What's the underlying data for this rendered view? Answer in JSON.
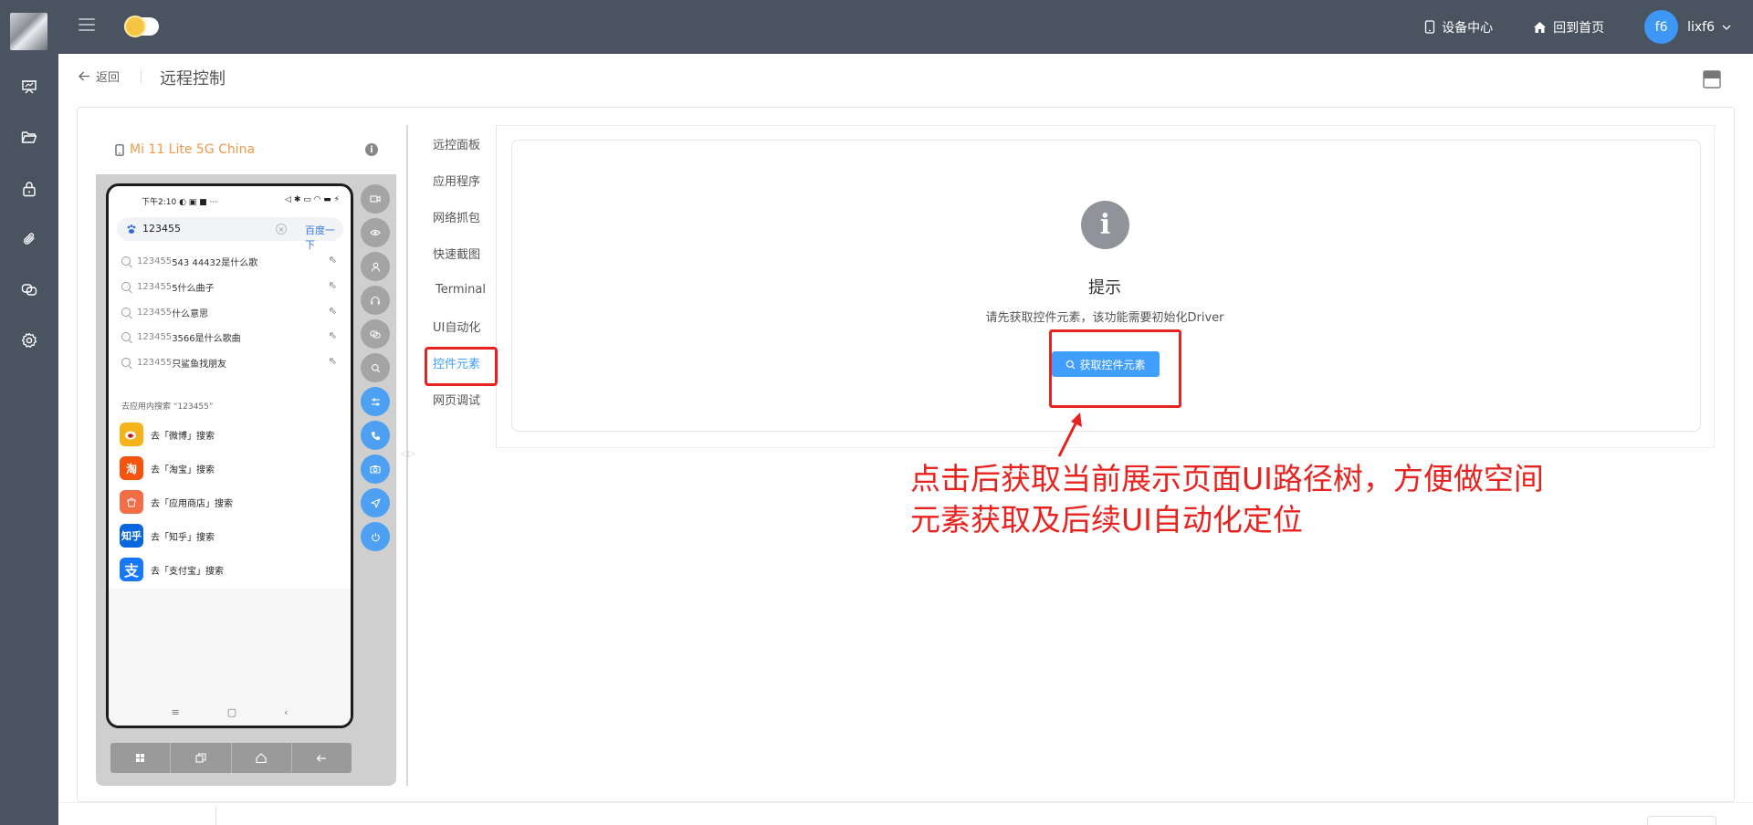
{
  "topbar": {
    "device_center": "设备中心",
    "back_home": "回到首页",
    "avatar_initials": "f6",
    "username": "lixf6"
  },
  "header": {
    "back_label": "返回",
    "title": "远程控制"
  },
  "device": {
    "name": "Mi 11 Lite 5G China",
    "status_time": "下午2:10",
    "search_value": "123455",
    "search_go": "百度一下",
    "suggestions": [
      {
        "prefix": "123455",
        "rest": "543 44432是什么歌"
      },
      {
        "prefix": "123455",
        "rest": "5什么曲子"
      },
      {
        "prefix": "123455",
        "rest": "什么意思"
      },
      {
        "prefix": "123455",
        "rest": "3566是什么歌曲"
      },
      {
        "prefix": "123455",
        "rest": "只鲨鱼找朋友"
      }
    ],
    "app_search_hint": "去应用内搜索 “123455”",
    "apps": [
      {
        "label": "去「微博」搜索",
        "icon": "weibo-icon",
        "color": "#f5b31b"
      },
      {
        "label": "去「淘宝」搜索",
        "icon": "taobao-icon",
        "color": "#f5530e",
        "glyph": "淘"
      },
      {
        "label": "去「应用商店」搜索",
        "icon": "app-store-icon",
        "color": "#f26e47"
      },
      {
        "label": "去「知乎」搜索",
        "icon": "zhihu-icon",
        "color": "#0a66db",
        "glyph": "知乎"
      },
      {
        "label": "去「支付宝」搜索",
        "icon": "alipay-icon",
        "color": "#1677ff",
        "glyph": "支"
      }
    ]
  },
  "tabs": [
    {
      "label": "远控面板",
      "active": false
    },
    {
      "label": "应用程序",
      "active": false
    },
    {
      "label": "网络抓包",
      "active": false
    },
    {
      "label": "快速截图",
      "active": false
    },
    {
      "label": "Terminal",
      "active": false
    },
    {
      "label": "UI自动化",
      "active": false
    },
    {
      "label": "控件元素",
      "active": true
    },
    {
      "label": "网页调试",
      "active": false
    }
  ],
  "tip": {
    "icon": "i",
    "title": "提示",
    "description": "请先获取控件元素，该功能需要初始化Driver",
    "button": "获取控件元素"
  },
  "annotation": {
    "line1": "点击后获取当前展示页面UI路径树，方便做空间",
    "line2": "元素获取及后续UI自动化定位"
  },
  "colors": {
    "topbar": "#4a5460",
    "accent": "#409eff",
    "annotation": "#e8231f",
    "device_name": "#f2994a"
  }
}
